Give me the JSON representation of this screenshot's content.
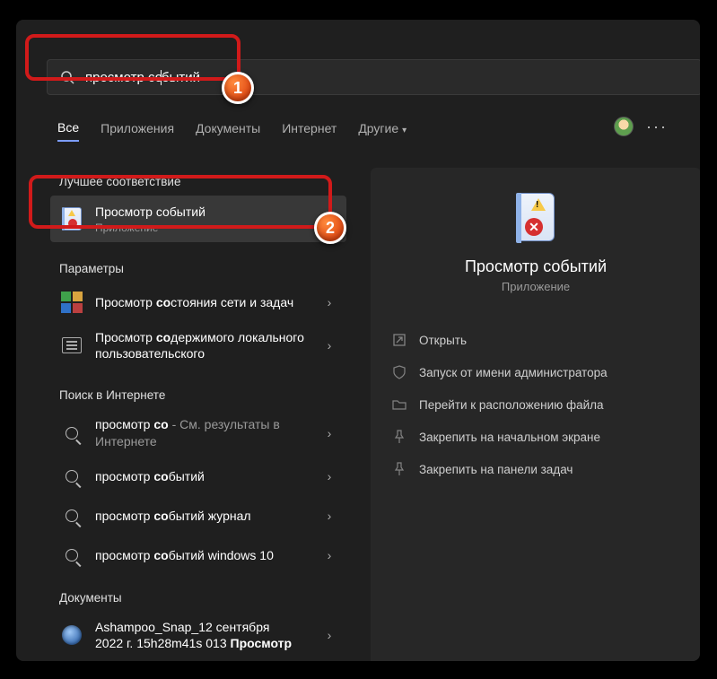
{
  "search": {
    "query_before": "просмотр со",
    "query_after": "бытий"
  },
  "tabs": {
    "all": "Все",
    "apps": "Приложения",
    "documents": "Документы",
    "internet": "Интернет",
    "other": "Другие"
  },
  "sections": {
    "best_match": "Лучшее соответствие",
    "settings": "Параметры",
    "web_search": "Поиск в Интернете",
    "documents": "Документы"
  },
  "best_match": {
    "title": "Просмотр событий",
    "subtitle": "Приложение"
  },
  "settings_results": [
    {
      "pre": "Просмотр ",
      "bold": "со",
      "post": "стояния сети и задач"
    },
    {
      "pre": "Просмотр ",
      "bold": "со",
      "post": "держимого локального пользовательского"
    }
  ],
  "web_results": [
    {
      "pre": "просмотр ",
      "bold": "со",
      "post_plain": "",
      "post_grey": " - См. результаты в Интернете"
    },
    {
      "pre": "просмотр ",
      "bold": "со",
      "post_plain": "бытий",
      "post_grey": ""
    },
    {
      "pre": "просмотр ",
      "bold": "со",
      "post_plain": "бытий журнал",
      "post_grey": ""
    },
    {
      "pre": "просмотр ",
      "bold": "со",
      "post_plain": "бытий windows 10",
      "post_grey": ""
    }
  ],
  "doc_result": {
    "line1": "Ashampoo_Snap_12 сентября",
    "line2_pre": "2022 г. 15h28m41s 013 ",
    "line2_bold": "Просмотр"
  },
  "details": {
    "title": "Просмотр событий",
    "subtitle": "Приложение",
    "actions": {
      "open": "Открыть",
      "run_admin": "Запуск от имени администратора",
      "open_location": "Перейти к расположению файла",
      "pin_start": "Закрепить на начальном экране",
      "pin_taskbar": "Закрепить на панели задач"
    }
  },
  "annotations": {
    "badge1": "1",
    "badge2": "2"
  }
}
